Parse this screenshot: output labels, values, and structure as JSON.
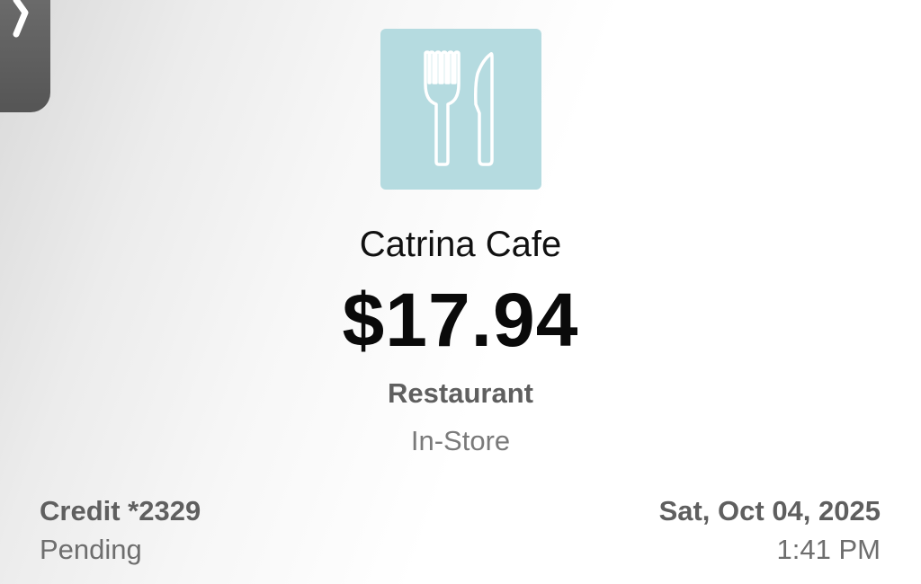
{
  "nav": {
    "back_icon": "chevron-right-icon"
  },
  "transaction": {
    "category_icon": "fork-knife-icon",
    "merchant": "Catrina Cafe",
    "amount": "$17.94",
    "category": "Restaurant",
    "channel": "In-Store",
    "account": "Credit *2329",
    "status": "Pending",
    "date": "Sat, Oct 04, 2025",
    "time": "1:41 PM"
  },
  "colors": {
    "tile_background": "#b5dbe0",
    "icon_stroke": "#ffffff",
    "back_tab": "#5c5c5c"
  }
}
